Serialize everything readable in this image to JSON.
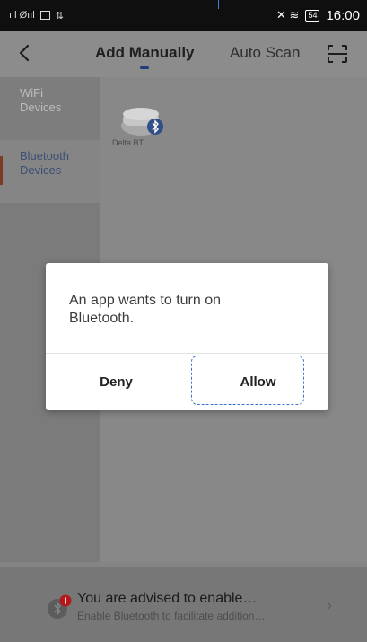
{
  "status_bar": {
    "left_indicators": "ııl Øııl",
    "right_indicators": "✕ ≋",
    "battery": "54",
    "time": "16:00"
  },
  "header": {
    "back_icon": "chevron-left-icon",
    "tabs": [
      {
        "label": "Add Manually",
        "active": true
      },
      {
        "label": "Auto Scan",
        "active": false
      }
    ],
    "scan_icon": "scan-icon"
  },
  "sidebar": {
    "items": [
      {
        "label": "WiFi\nDevices",
        "active": false
      },
      {
        "label": "Bluetooth\nDevices",
        "active": true
      }
    ]
  },
  "devices": [
    {
      "label": "Delta BT",
      "icon": "bluetooth-icon"
    }
  ],
  "dialog": {
    "message": "An app wants to turn on Bluetooth.",
    "deny_label": "Deny",
    "allow_label": "Allow"
  },
  "banner": {
    "title": "You are advised to enable…",
    "subtitle": "Enable Bluetooth to facilitate addition…",
    "arrow": "›"
  },
  "colors": {
    "accent_blue": "#3a72c9",
    "active_tab_indicator": "#1f3f7a",
    "alert_red": "#d8262b"
  }
}
